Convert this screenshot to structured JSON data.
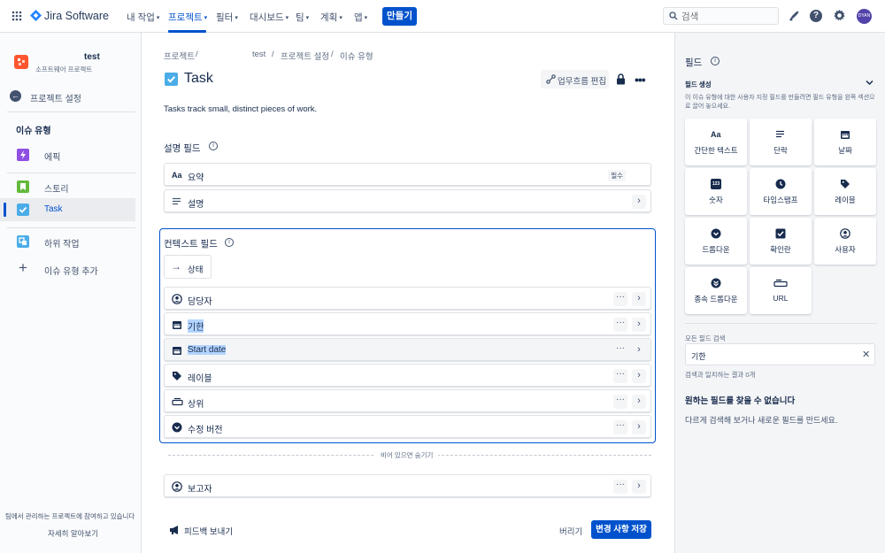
{
  "topnav": {
    "product_name": "Jira Software",
    "items": [
      {
        "label": "내 작업"
      },
      {
        "label": "프로젝트"
      },
      {
        "label": "필터"
      },
      {
        "label": "대시보드"
      },
      {
        "label": "팀"
      },
      {
        "label": "계획"
      },
      {
        "label": "앱"
      }
    ],
    "create_label": "만들기",
    "search_placeholder": "검색",
    "avatar_initials": "DYAN"
  },
  "sidebar": {
    "project_name": "test",
    "project_type": "소프트웨어 프로젝트",
    "back_label": "프로젝트 설정",
    "section_title": "이슈 유형",
    "items": [
      {
        "label": "에픽",
        "icon": "epic-icon",
        "color": "#904ee2"
      },
      {
        "label": "스토리",
        "icon": "story-icon",
        "color": "#63ba3c"
      },
      {
        "label": "Task",
        "icon": "task-icon",
        "color": "#4bade8"
      },
      {
        "label": "하위 작업",
        "icon": "subtask-icon",
        "color": "#4bade8"
      },
      {
        "label": "이슈 유형 추가",
        "icon": "plus-icon",
        "color": "#42526e"
      }
    ],
    "footer_text": "팀에서 관리하는 프로젝트에 참여하고 있습니다",
    "footer_link": "자세히 알아보기"
  },
  "breadcrumb": [
    "프로젝트",
    "test",
    "프로젝트 설정",
    "이슈 유형"
  ],
  "issue": {
    "title": "Task",
    "description": "Tasks track small, distinct pieces of work.",
    "workflow_button": "업무흐름 편집"
  },
  "description_fields": {
    "title": "설명 필드",
    "rows": [
      {
        "label": "요약",
        "badge": "필수",
        "icon": "text-aa-icon"
      },
      {
        "label": "설명",
        "icon": "paragraph-icon"
      }
    ]
  },
  "context_fields": {
    "title": "컨텍스트 필드",
    "status_label": "상태",
    "rows": [
      {
        "label": "담당자",
        "icon": "user-icon"
      },
      {
        "label": "기한",
        "icon": "calendar-icon"
      },
      {
        "label": "Start date",
        "icon": "calendar-icon"
      },
      {
        "label": "레이블",
        "icon": "label-icon"
      },
      {
        "label": "상위",
        "icon": "parent-icon"
      },
      {
        "label": "수정 버전",
        "icon": "dropdown-icon"
      }
    ],
    "divider_label": "비어 있으면 숨기기",
    "hidden_rows": [
      {
        "label": "보고자",
        "icon": "user-icon"
      }
    ]
  },
  "footer": {
    "feedback_label": "피드백 보내기",
    "discard_label": "버리기",
    "save_label": "변경 사항 저장"
  },
  "right_panel": {
    "title": "필드",
    "section_title": "필드 생성",
    "section_desc": "이 이슈 유형에 대한 사용자 지정 필드를 만들려면 필드 유형을 왼쪽 섹션으로 끌어 놓으세요.",
    "tiles": [
      {
        "label": "간단한 텍스트",
        "icon": "text-aa-icon"
      },
      {
        "label": "단락",
        "icon": "paragraph-icon"
      },
      {
        "label": "날짜",
        "icon": "calendar-icon"
      },
      {
        "label": "숫자",
        "icon": "number-icon"
      },
      {
        "label": "타임스탬프",
        "icon": "clock-icon"
      },
      {
        "label": "레이블",
        "icon": "label-icon"
      },
      {
        "label": "드롭다운",
        "icon": "dropdown-icon"
      },
      {
        "label": "확인란",
        "icon": "checkbox-icon"
      },
      {
        "label": "사용자",
        "icon": "user-icon"
      },
      {
        "label": "종속 드롭다운",
        "icon": "cascade-dropdown-icon"
      },
      {
        "label": "URL",
        "icon": "url-icon"
      }
    ],
    "search_label": "모든 필드 검색",
    "search_value": "기한",
    "result_text": "검색과 일치하는 결과 0개",
    "not_found_title": "원하는 필드를 찾을 수 없습니다",
    "not_found_desc": "다르게 검색해 보거나 새로운 필드를 만드세요."
  },
  "colors": {
    "accent": "#0052cc",
    "context_border": "#0052cc",
    "highlight": "#b3d4ff"
  }
}
